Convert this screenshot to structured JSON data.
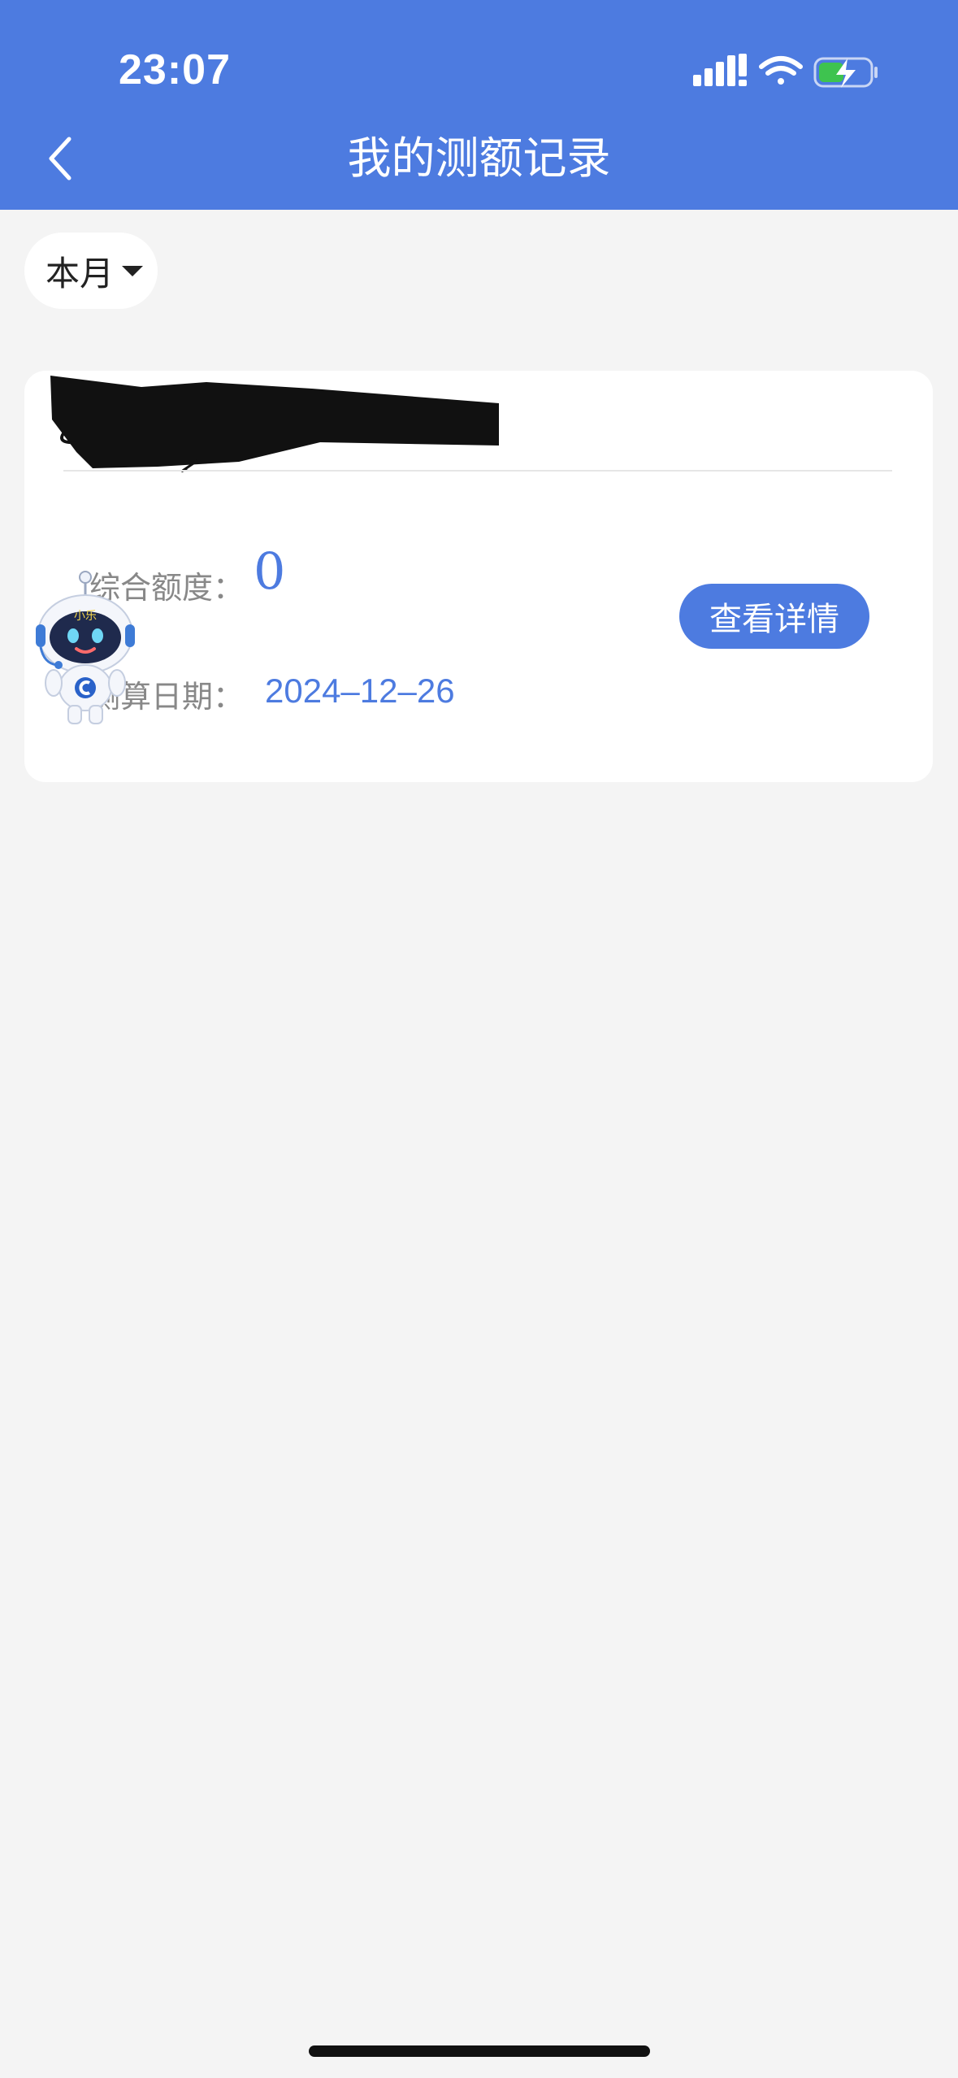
{
  "status_bar": {
    "time": "23:07"
  },
  "header": {
    "title": "我的测额记录"
  },
  "filter": {
    "selected": "本月"
  },
  "record": {
    "amount_label": "综合额度：",
    "amount_value": "0",
    "date_label": "测算日期：",
    "date_value": "2024–12–26",
    "detail_button": "查看详情"
  },
  "mascot": {
    "badge_text": "小乐"
  },
  "colors": {
    "accent": "#4d7be0",
    "background": "#f4f4f4",
    "card": "#ffffff"
  }
}
